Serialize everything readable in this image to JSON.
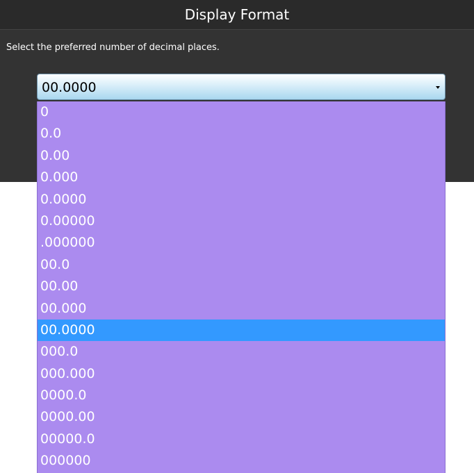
{
  "dialog": {
    "title": "Display Format",
    "instruction": "Select the preferred number of decimal places."
  },
  "select": {
    "value": "00.0000",
    "options": [
      "0",
      "0.0",
      "0.00",
      "0.000",
      "0.0000",
      "0.00000",
      ".000000",
      "00.0",
      "00.00",
      "00.000",
      "00.0000",
      "000.0",
      "000.000",
      "0000.0",
      "0000.00",
      "00000.0",
      "000000"
    ],
    "selected_index": 10
  },
  "colors": {
    "dialog_background": "#333333",
    "list_background": "#ab8bef",
    "selected_highlight": "#3399ff"
  }
}
